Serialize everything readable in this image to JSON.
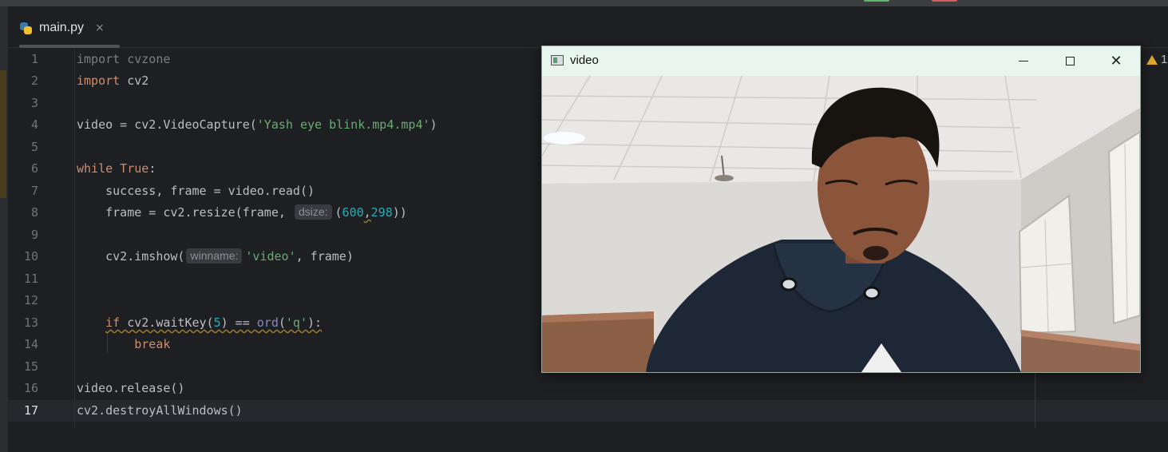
{
  "colors": {
    "editor_bg": "#1e1f22",
    "keyword": "#cf8e6d",
    "string": "#6aab73",
    "number": "#2aacb8",
    "text": "#bcbec4",
    "window_title_bg": "#e8f6ef"
  },
  "editor_tab": {
    "label": "main.py",
    "close_glyph": "×",
    "icon": "python-file-icon"
  },
  "inspections": {
    "warnings": "1"
  },
  "lines": [
    {
      "n": "1"
    },
    {
      "n": "2"
    },
    {
      "n": "3"
    },
    {
      "n": "4"
    },
    {
      "n": "5"
    },
    {
      "n": "6"
    },
    {
      "n": "7"
    },
    {
      "n": "8"
    },
    {
      "n": "9"
    },
    {
      "n": "10"
    },
    {
      "n": "11"
    },
    {
      "n": "12"
    },
    {
      "n": "13"
    },
    {
      "n": "14"
    },
    {
      "n": "15"
    },
    {
      "n": "16"
    },
    {
      "n": "17"
    }
  ],
  "code": {
    "l1_kw": "import",
    "l1_mod": " cvzone",
    "l2_kw": "import",
    "l2_mod": " cv2",
    "l4_a": "video = cv2.VideoCapture(",
    "l4_str": "'Yash eye blink.mp4.mp4'",
    "l4_b": ")",
    "l6_kw": "while",
    "l6_true": " True",
    "l6_colon": ":",
    "l7": "    success, frame = video.read()",
    "l8_a": "    frame = cv2.resize(frame, ",
    "l8_hint": "dsize:",
    "l8_b": "(",
    "l8_n1": "600",
    "l8_comma": ",",
    "l8_n2": "298",
    "l8_c": "))",
    "l10_a": "    cv2.imshow(",
    "l10_hint": "winname:",
    "l10_str": "'video'",
    "l10_b": ", frame)",
    "l13_indent": "    ",
    "l13_kw": "if",
    "l13_a": " cv2.waitKey(",
    "l13_num": "5",
    "l13_b": ") == ",
    "l13_fn": "ord",
    "l13_c": "(",
    "l13_str": "'q'",
    "l13_d": "):",
    "l14_indent": "        ",
    "l14_kw": "break",
    "l16": "video.release()",
    "l17": "cv2.destroyAllWindows()"
  },
  "video_window": {
    "title": "video",
    "minimize_glyph": "",
    "close_glyph": "✕"
  }
}
